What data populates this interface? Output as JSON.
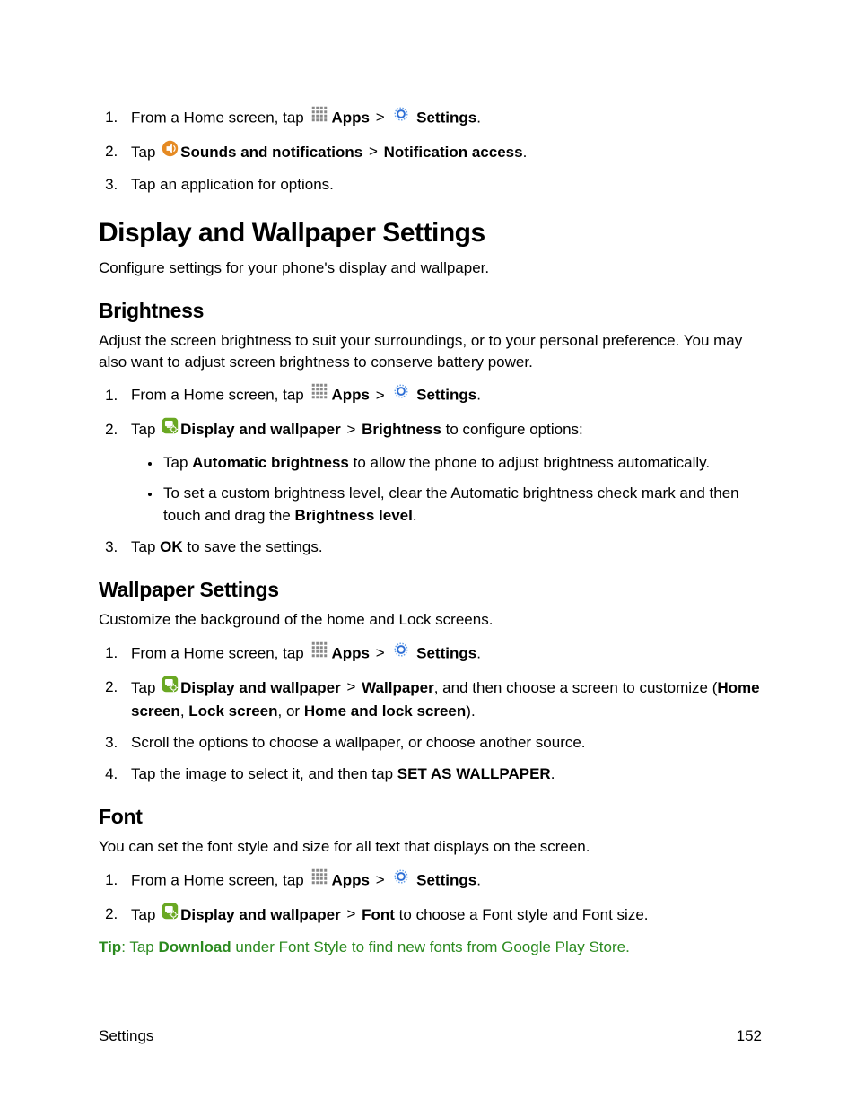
{
  "topList": {
    "item1": {
      "prefix": "From a Home screen, tap",
      "apps": "Apps",
      "gt": ">",
      "settings": "Settings",
      "dot": "."
    },
    "item2": {
      "prefix": "Tap",
      "sounds": "Sounds and notifications",
      "gt": ">",
      "notif": "Notification access",
      "dot": "."
    },
    "item3": "Tap an application for options."
  },
  "section1": {
    "heading": "Display and Wallpaper Settings",
    "intro": "Configure settings for your phone's display and wallpaper."
  },
  "brightness": {
    "heading": "Brightness",
    "intro": "Adjust the screen brightness to suit your surroundings, or to your personal preference. You may also want to adjust screen brightness to conserve battery power.",
    "item1": {
      "prefix": "From a Home screen, tap",
      "apps": "Apps",
      "gt": ">",
      "settings": "Settings",
      "dot": "."
    },
    "item2": {
      "prefix": "Tap",
      "displayWallpaper": "Display and wallpaper",
      "gt": ">",
      "brightness": "Brightness",
      "suffix": " to configure options:"
    },
    "sub1": {
      "prefix": "Tap ",
      "auto": "Automatic brightness",
      "suffix": " to allow the phone to adjust brightness automatically."
    },
    "sub2": {
      "prefix": "To set a custom brightness level, clear the Automatic brightness check mark and then touch and drag the ",
      "level": "Brightness level",
      "dot": "."
    },
    "item3": {
      "prefix": "Tap ",
      "ok": "OK",
      "suffix": " to save the settings."
    }
  },
  "wallpaper": {
    "heading": "Wallpaper Settings",
    "intro": "Customize the background of the home and Lock screens.",
    "item1": {
      "prefix": "From a Home screen, tap",
      "apps": "Apps",
      "gt": ">",
      "settings": "Settings",
      "dot": "."
    },
    "item2": {
      "prefix": "Tap",
      "displayWallpaper": "Display and wallpaper",
      "gt": ">",
      "wallpaper": "Wallpaper",
      "mid": ", and then choose a screen to customize (",
      "home": "Home screen",
      "c1": ", ",
      "lock": "Lock screen",
      "c2": ", or ",
      "both": "Home and lock screen",
      "end": ")."
    },
    "item3": "Scroll the options to choose a wallpaper, or choose another source.",
    "item4": {
      "prefix": "Tap the image to select it, and then tap ",
      "set": "SET AS WALLPAPER",
      "dot": "."
    }
  },
  "font": {
    "heading": "Font",
    "intro": "You can set the font style and size for all text that displays on the screen.",
    "item1": {
      "prefix": "From a Home screen, tap",
      "apps": "Apps",
      "gt": ">",
      "settings": "Settings",
      "dot": "."
    },
    "item2": {
      "prefix": "Tap",
      "displayWallpaper": "Display and wallpaper",
      "gt": ">",
      "font": "Font",
      "suffix": " to choose a Font style and Font size."
    },
    "tipLabel": "Tip",
    "tipColon": ": Tap ",
    "tipDownload": "Download",
    "tipRest": " under Font Style to find new fonts from Google Play Store."
  },
  "footer": {
    "left": "Settings",
    "right": "152"
  }
}
